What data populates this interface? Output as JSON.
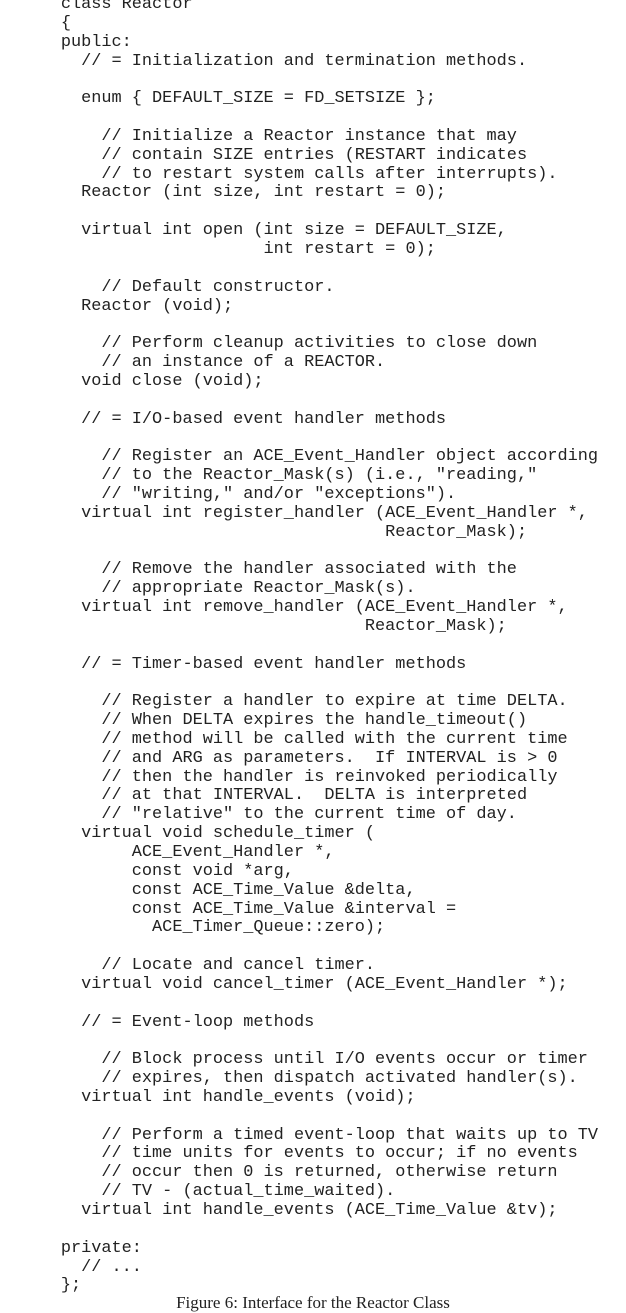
{
  "code_lines": [
    "      class Reactor",
    "      {",
    "      public:",
    "        // = Initialization and termination methods.",
    "",
    "        enum { DEFAULT_SIZE = FD_SETSIZE };",
    "",
    "          // Initialize a Reactor instance that may",
    "          // contain SIZE entries (RESTART indicates",
    "          // to restart system calls after interrupts).",
    "        Reactor (int size, int restart = 0);",
    "",
    "        virtual int open (int size = DEFAULT_SIZE,",
    "                          int restart = 0);",
    "",
    "          // Default constructor.",
    "        Reactor (void);",
    "",
    "          // Perform cleanup activities to close down",
    "          // an instance of a REACTOR.",
    "        void close (void);",
    "",
    "        // = I/O-based event handler methods",
    "",
    "          // Register an ACE_Event_Handler object according",
    "          // to the Reactor_Mask(s) (i.e., \"reading,\"",
    "          // \"writing,\" and/or \"exceptions\").",
    "        virtual int register_handler (ACE_Event_Handler *,",
    "                                      Reactor_Mask);",
    "",
    "          // Remove the handler associated with the",
    "          // appropriate Reactor_Mask(s).",
    "        virtual int remove_handler (ACE_Event_Handler *,",
    "                                    Reactor_Mask);",
    "",
    "        // = Timer-based event handler methods",
    "",
    "          // Register a handler to expire at time DELTA.",
    "          // When DELTA expires the handle_timeout()",
    "          // method will be called with the current time",
    "          // and ARG as parameters.  If INTERVAL is > 0",
    "          // then the handler is reinvoked periodically",
    "          // at that INTERVAL.  DELTA is interpreted",
    "          // \"relative\" to the current time of day.",
    "        virtual void schedule_timer (",
    "             ACE_Event_Handler *,",
    "             const void *arg,",
    "             const ACE_Time_Value &delta,",
    "             const ACE_Time_Value &interval =",
    "               ACE_Timer_Queue::zero);",
    "",
    "          // Locate and cancel timer.",
    "        virtual void cancel_timer (ACE_Event_Handler *);",
    "",
    "        // = Event-loop methods",
    "",
    "          // Block process until I/O events occur or timer",
    "          // expires, then dispatch activated handler(s).",
    "        virtual int handle_events (void);",
    "",
    "          // Perform a timed event-loop that waits up to TV",
    "          // time units for events to occur; if no events",
    "          // occur then 0 is returned, otherwise return",
    "          // TV - (actual_time_waited).",
    "        virtual int handle_events (ACE_Time_Value &tv);",
    "",
    "      private:",
    "        // ...",
    "      };"
  ],
  "caption": "Figure 6: Interface for the Reactor Class"
}
